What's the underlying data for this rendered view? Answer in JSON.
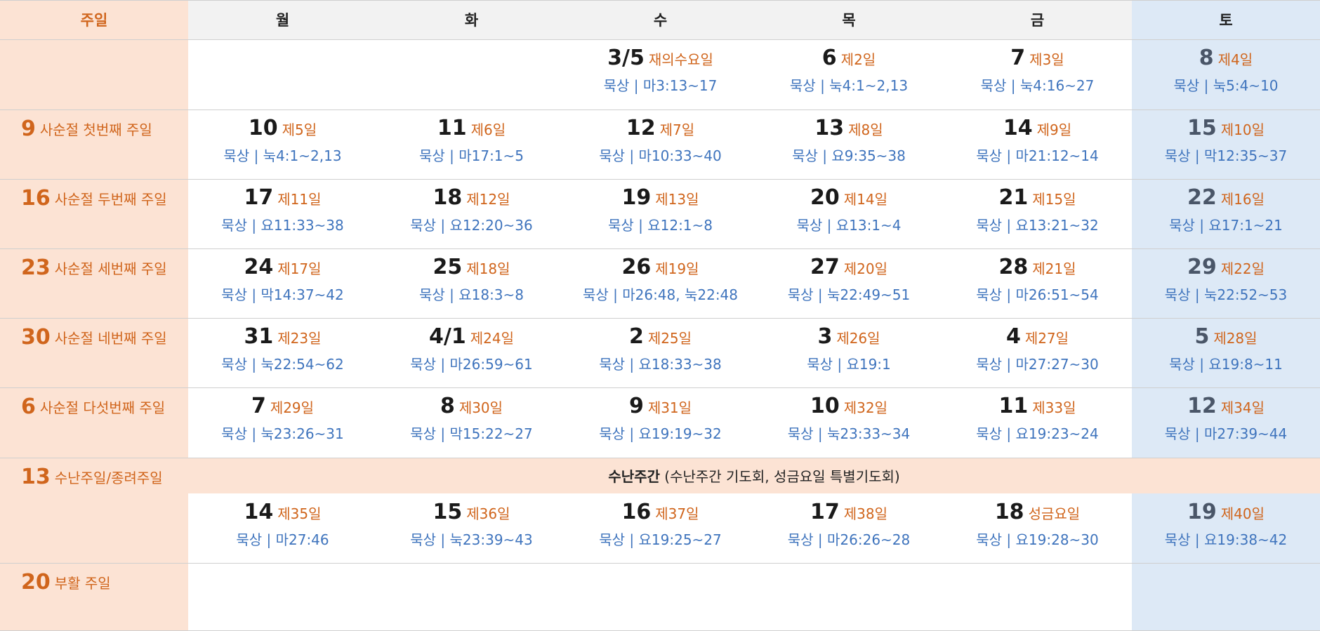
{
  "headers": [
    "주일",
    "월",
    "화",
    "수",
    "목",
    "금",
    "토"
  ],
  "weeks": [
    {
      "sunday": {
        "num": "",
        "label": ""
      },
      "days": [
        null,
        null,
        {
          "num": "3/5",
          "label": "재의수요일",
          "sub": "묵상 | 마3:13~17"
        },
        {
          "num": "6",
          "label": "제2일",
          "sub": "묵상 | 눅4:1~2,13"
        },
        {
          "num": "7",
          "label": "제3일",
          "sub": "묵상 | 눅4:16~27"
        },
        {
          "num": "8",
          "label": "제4일",
          "sub": "묵상 | 눅5:4~10"
        }
      ]
    },
    {
      "sunday": {
        "num": "9",
        "label": "사순절 첫번째 주일"
      },
      "days": [
        {
          "num": "10",
          "label": "제5일",
          "sub": "묵상 | 눅4:1~2,13"
        },
        {
          "num": "11",
          "label": "제6일",
          "sub": "묵상 | 마17:1~5"
        },
        {
          "num": "12",
          "label": "제7일",
          "sub": "묵상 | 마10:33~40"
        },
        {
          "num": "13",
          "label": "제8일",
          "sub": "묵상 | 요9:35~38"
        },
        {
          "num": "14",
          "label": "제9일",
          "sub": "묵상 | 마21:12~14"
        },
        {
          "num": "15",
          "label": "제10일",
          "sub": "묵상 | 막12:35~37"
        }
      ]
    },
    {
      "sunday": {
        "num": "16",
        "label": "사순절 두번째 주일"
      },
      "days": [
        {
          "num": "17",
          "label": "제11일",
          "sub": "묵상 | 요11:33~38"
        },
        {
          "num": "18",
          "label": "제12일",
          "sub": "묵상 | 요12:20~36"
        },
        {
          "num": "19",
          "label": "제13일",
          "sub": "묵상 | 요12:1~8"
        },
        {
          "num": "20",
          "label": "제14일",
          "sub": "묵상 | 요13:1~4"
        },
        {
          "num": "21",
          "label": "제15일",
          "sub": "묵상 | 요13:21~32"
        },
        {
          "num": "22",
          "label": "제16일",
          "sub": "묵상 | 요17:1~21"
        }
      ]
    },
    {
      "sunday": {
        "num": "23",
        "label": "사순절 세번째 주일"
      },
      "days": [
        {
          "num": "24",
          "label": "제17일",
          "sub": "묵상 | 막14:37~42"
        },
        {
          "num": "25",
          "label": "제18일",
          "sub": "묵상 | 요18:3~8"
        },
        {
          "num": "26",
          "label": "제19일",
          "sub": "묵상 | 마26:48, 눅22:48"
        },
        {
          "num": "27",
          "label": "제20일",
          "sub": "묵상 | 눅22:49~51"
        },
        {
          "num": "28",
          "label": "제21일",
          "sub": "묵상 | 마26:51~54"
        },
        {
          "num": "29",
          "label": "제22일",
          "sub": "묵상 | 눅22:52~53"
        }
      ]
    },
    {
      "sunday": {
        "num": "30",
        "label": "사순절 네번째 주일"
      },
      "days": [
        {
          "num": "31",
          "label": "제23일",
          "sub": "묵상 | 눅22:54~62"
        },
        {
          "num": "4/1",
          "label": "제24일",
          "sub": "묵상 | 마26:59~61"
        },
        {
          "num": "2",
          "label": "제25일",
          "sub": "묵상 | 요18:33~38"
        },
        {
          "num": "3",
          "label": "제26일",
          "sub": "묵상 | 요19:1"
        },
        {
          "num": "4",
          "label": "제27일",
          "sub": "묵상 | 마27:27~30"
        },
        {
          "num": "5",
          "label": "제28일",
          "sub": "묵상 | 요19:8~11"
        }
      ]
    },
    {
      "sunday": {
        "num": "6",
        "label": "사순절 다섯번째 주일"
      },
      "days": [
        {
          "num": "7",
          "label": "제29일",
          "sub": "묵상 | 눅23:26~31"
        },
        {
          "num": "8",
          "label": "제30일",
          "sub": "묵상 | 막15:22~27"
        },
        {
          "num": "9",
          "label": "제31일",
          "sub": "묵상 | 요19:19~32"
        },
        {
          "num": "10",
          "label": "제32일",
          "sub": "묵상 | 눅23:33~34"
        },
        {
          "num": "11",
          "label": "제33일",
          "sub": "묵상 | 요19:23~24"
        },
        {
          "num": "12",
          "label": "제34일",
          "sub": "묵상 | 마27:39~44"
        }
      ]
    },
    {
      "sunday": {
        "num": "13",
        "label": "수난주일/종려주일"
      },
      "banner": {
        "bold": "수난주간",
        "rest": " (수난주간 기도회, 성금요일 특별기도회)"
      },
      "days": [
        {
          "num": "14",
          "label": "제35일",
          "sub": "묵상 | 마27:46"
        },
        {
          "num": "15",
          "label": "제36일",
          "sub": "묵상 | 눅23:39~43"
        },
        {
          "num": "16",
          "label": "제37일",
          "sub": "묵상 | 요19:25~27"
        },
        {
          "num": "17",
          "label": "제38일",
          "sub": "묵상 | 마26:26~28"
        },
        {
          "num": "18",
          "label": "성금요일",
          "sub": "묵상 | 요19:28~30"
        },
        {
          "num": "19",
          "label": "제40일",
          "sub": "묵상 | 요19:38~42"
        }
      ]
    },
    {
      "sunday": {
        "num": "20",
        "label": "부활 주일"
      },
      "days": [
        null,
        null,
        null,
        null,
        null,
        null
      ]
    }
  ]
}
